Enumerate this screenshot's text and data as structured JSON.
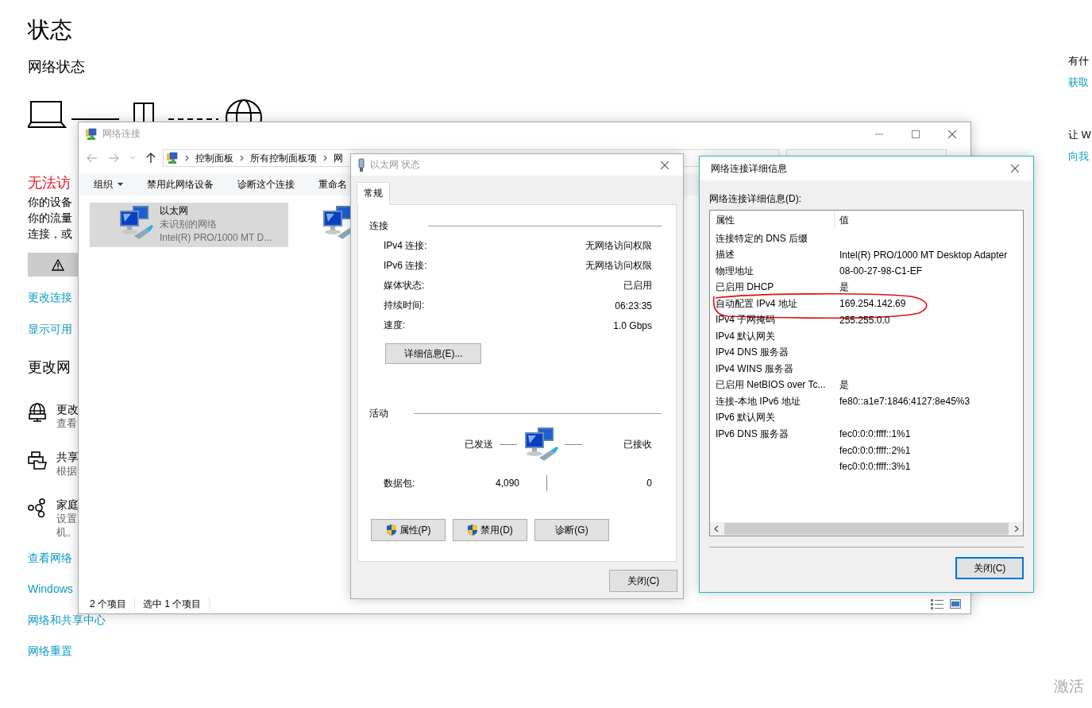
{
  "settings": {
    "title": "状态",
    "subtitle": "网络状态",
    "alert": "无法访",
    "alert_lines": [
      "你的设备",
      "你的流量",
      "连接，或"
    ],
    "links_top": [
      "更改连接",
      "显示可用"
    ],
    "section": "更改网",
    "options": [
      {
        "kind": "adapter",
        "title": "更改",
        "lines": [
          "查看"
        ]
      },
      {
        "kind": "sharing",
        "title": "共享",
        "lines": [
          "根据"
        ]
      },
      {
        "kind": "homegroup",
        "title": "家庭",
        "lines": [
          "设置",
          "机。"
        ]
      }
    ],
    "links_bottom": [
      "查看网络",
      "Windows",
      "网络和共享中心",
      "网络重置"
    ],
    "aside": [
      {
        "kind": "text",
        "text": "有什"
      },
      {
        "kind": "link",
        "text": "获取"
      },
      {
        "kind": "text",
        "text": "让 W"
      },
      {
        "kind": "link",
        "text": "向我"
      }
    ],
    "activation": "激活"
  },
  "network_connections": {
    "title": "网络连接",
    "active": false,
    "breadcrumb": [
      "控制面板",
      "所有控制面板项",
      "网"
    ],
    "toolbar": [
      {
        "label": "组织",
        "dropdown": true
      },
      {
        "label": "禁用此网络设备",
        "dropdown": false
      },
      {
        "label": "诊断这个连接",
        "dropdown": false
      },
      {
        "label": "重命名",
        "dropdown": false
      }
    ],
    "items": [
      {
        "name": "以太网",
        "status": "未识别的网络",
        "device": "Intel(R) PRO/1000 MT D...",
        "selected": true
      },
      {
        "selected": false
      }
    ],
    "status_bar": [
      "2 个项目",
      "选中 1 个项目"
    ]
  },
  "status_dialog": {
    "title": "以太网 状态",
    "active": false,
    "tabs": [
      {
        "label": "常规",
        "selected": true
      }
    ],
    "connection_heading": "连接",
    "connection_rows": [
      {
        "label": "IPv4 连接:",
        "value": "无网络访问权限"
      },
      {
        "label": "IPv6 连接:",
        "value": "无网络访问权限"
      },
      {
        "label": "媒体状态:",
        "value": "已启用"
      },
      {
        "label": "持续时间:",
        "value": "06:23:35"
      },
      {
        "label": "速度:",
        "value": "1.0 Gbps"
      }
    ],
    "details_button": "详细信息(E)...",
    "activity_heading": "活动",
    "sent_label": "已发送",
    "received_label": "已接收",
    "packets_label": "数据包:",
    "packets_sent": "4,090",
    "packets_received": "0",
    "buttons": [
      {
        "label": "属性(P)",
        "shield": true
      },
      {
        "label": "禁用(D)",
        "shield": true
      },
      {
        "label": "诊断(G)",
        "shield": false
      }
    ],
    "close_button": "关闭(C)"
  },
  "details_dialog": {
    "title": "网络连接详细信息",
    "active": true,
    "list_label": "网络连接详细信息(D):",
    "columns": [
      "属性",
      "值"
    ],
    "rows": [
      {
        "property": "连接特定的 DNS 后缀",
        "circled": false
      },
      {
        "property": "描述",
        "value": "Intel(R) PRO/1000 MT Desktop Adapter",
        "circled": false
      },
      {
        "property": "物理地址",
        "value": "08-00-27-98-C1-EF",
        "circled": false
      },
      {
        "property": "已启用 DHCP",
        "value": "是",
        "circled": false
      },
      {
        "property": "自动配置 IPv4 地址",
        "value": "169.254.142.69",
        "circled": true
      },
      {
        "property": "IPv4 子网掩码",
        "value": "255.255.0.0",
        "circled": false
      },
      {
        "property": "IPv4 默认网关",
        "circled": false
      },
      {
        "property": "IPv4 DNS 服务器",
        "circled": false
      },
      {
        "property": "IPv4 WINS 服务器",
        "circled": false
      },
      {
        "property": "已启用 NetBIOS over Tc...",
        "value": "是",
        "circled": false
      },
      {
        "property": "连接-本地 IPv6 地址",
        "value": "fe80::a1e7:1846:4127:8e45%3",
        "circled": false
      },
      {
        "property": "IPv6 默认网关",
        "circled": false
      },
      {
        "property": "IPv6 DNS 服务器",
        "value": "fec0:0:0:ffff::1%1",
        "circled": false
      },
      {
        "value": "fec0:0:0:ffff::2%1",
        "circled": false
      },
      {
        "value": "fec0:0:0:ffff::3%1",
        "circled": false
      }
    ],
    "close_button": "关闭(C)"
  }
}
